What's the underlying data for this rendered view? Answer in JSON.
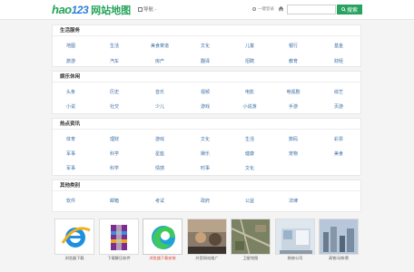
{
  "header": {
    "logo_hao": "hao",
    "logo_num": "123",
    "logo_sub": "网站地图",
    "nav_label": "导航 -",
    "help_label": "一键登录",
    "search_placeholder": "",
    "search_button": "搜索"
  },
  "sections": [
    {
      "title": "生活服务",
      "items": [
        "地图",
        "生活",
        "美食菜谱",
        "文化",
        "儿童",
        "银行",
        "基金",
        "旅游",
        "汽车",
        "房产",
        "翻译",
        "招聘",
        "教育",
        "财经"
      ]
    },
    {
      "title": "娱乐休闲",
      "items": [
        "头条",
        "历史",
        "音乐",
        "视频",
        "电影",
        "电视剧",
        "综艺",
        "小说",
        "社交",
        "少儿",
        "游戏",
        "小说游",
        "手游",
        "页游"
      ]
    },
    {
      "title": "热点资讯",
      "items": [
        "体育",
        "理财",
        "游戏",
        "文化",
        "生活",
        "数码",
        "彩票",
        "军事",
        "科学",
        "星座",
        "娱乐",
        "健康",
        "宠物",
        "美食",
        "军事",
        "科学",
        "情感",
        "时事",
        "文化"
      ]
    },
    {
      "title": "其他类别",
      "items": [
        "软件",
        "邮箱",
        "考试",
        "政府",
        "公益",
        "法律"
      ]
    }
  ],
  "thumbnails": [
    {
      "caption": "浏览器下载",
      "icon": "ie-browser-icon"
    },
    {
      "caption": "下载解压软件",
      "icon": "winrar-icon"
    },
    {
      "caption": "浏览器下载安装",
      "icon": "edge-browser-icon"
    },
    {
      "caption": "外贸网站推广",
      "icon": "photo-icon"
    },
    {
      "caption": "卫星地图",
      "icon": "map-icon"
    },
    {
      "caption": "装修公司",
      "icon": "house-icon"
    },
    {
      "caption": "高铁/动车票",
      "icon": "city-icon"
    },
    {
      "caption": "霓虹灯",
      "icon": "lights-icon"
    }
  ]
}
